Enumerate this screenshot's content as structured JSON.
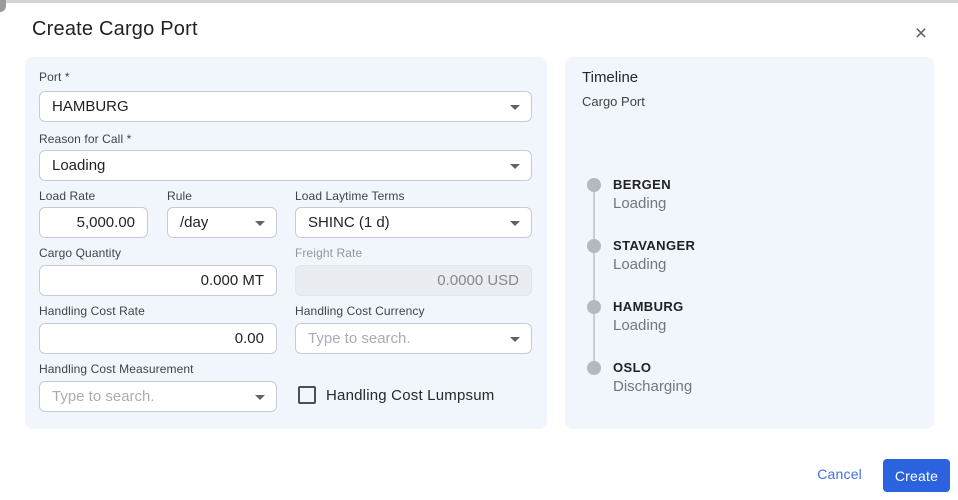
{
  "dialog": {
    "title": "Create Cargo Port",
    "close_icon": "×"
  },
  "form": {
    "port": {
      "label": "Port *",
      "value": "HAMBURG"
    },
    "reason_for_call": {
      "label": "Reason for Call *",
      "value": "Loading"
    },
    "load_rate": {
      "label": "Load Rate",
      "value": "5,000.00"
    },
    "rule": {
      "label": "Rule",
      "value": "/day"
    },
    "load_laytime_terms": {
      "label": "Load Laytime Terms",
      "value": "SHINC (1 d)"
    },
    "cargo_quantity": {
      "label": "Cargo Quantity",
      "value": "0.000 MT"
    },
    "freight_rate": {
      "label": "Freight Rate",
      "value": "0.0000 USD",
      "state": "disabled"
    },
    "handling_cost_rate": {
      "label": "Handling Cost Rate",
      "value": "0.00"
    },
    "handling_cost_currency": {
      "label": "Handling Cost Currency",
      "placeholder": "Type to search."
    },
    "handling_cost_measurement": {
      "label": "Handling Cost Measurement",
      "placeholder": "Type to search."
    },
    "handling_cost_lumpsum": {
      "label": "Handling Cost Lumpsum",
      "checked": false
    }
  },
  "timeline": {
    "title": "Timeline",
    "subtitle": "Cargo Port",
    "items": [
      {
        "port": "BERGEN",
        "action": "Loading"
      },
      {
        "port": "STAVANGER",
        "action": "Loading"
      },
      {
        "port": "HAMBURG",
        "action": "Loading"
      },
      {
        "port": "OSLO",
        "action": "Discharging"
      }
    ]
  },
  "footer": {
    "cancel_label": "Cancel",
    "create_label": "Create"
  },
  "colors": {
    "accent_blue": "#2b63de",
    "link_blue": "#4170e0",
    "panel_bg": "#f1f5fc",
    "disabled_bg": "#e9ecf1",
    "timeline_dot": "#b5b8bd"
  }
}
